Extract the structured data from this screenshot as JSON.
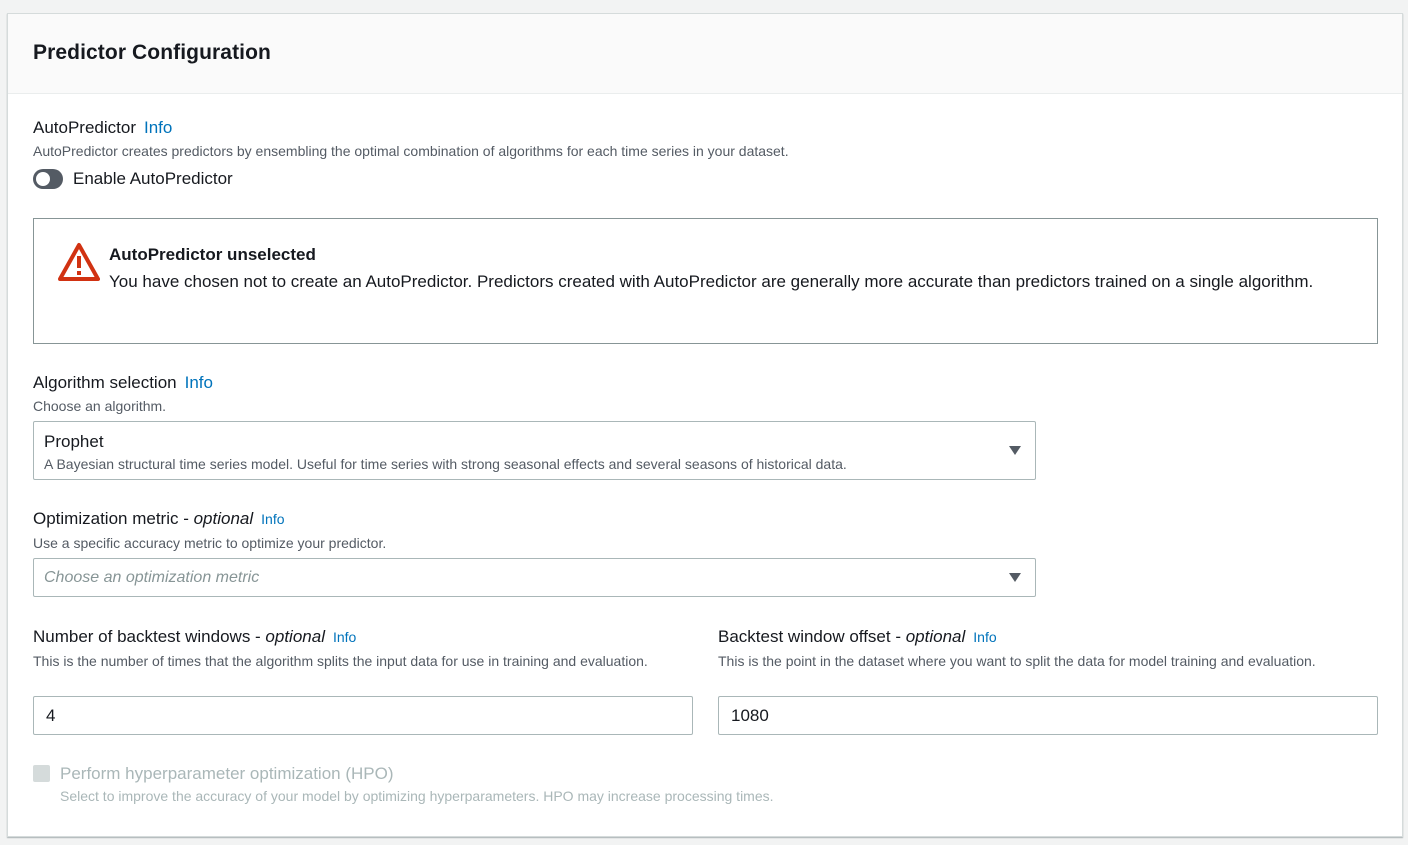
{
  "panel": {
    "title": "Predictor Configuration"
  },
  "autopredictor": {
    "label": "AutoPredictor",
    "info": "Info",
    "description": "AutoPredictor creates predictors by ensembling the optimal combination of algorithms for each time series in your dataset.",
    "toggle_label": "Enable AutoPredictor",
    "enabled": false
  },
  "alert": {
    "icon": "warning-triangle-icon",
    "title": "AutoPredictor unselected",
    "text": "You have chosen not to create an AutoPredictor. Predictors created with AutoPredictor are generally more accurate than predictors trained on a single algorithm."
  },
  "algorithm": {
    "label": "Algorithm selection",
    "info": "Info",
    "description": "Choose an algorithm.",
    "selected_value": "Prophet",
    "selected_description": "A Bayesian structural time series model. Useful for time series with strong seasonal effects and several seasons of historical data."
  },
  "optimization": {
    "label": "Optimization metric - ",
    "label_optional": "optional",
    "info": "Info",
    "description": "Use a specific accuracy metric to optimize your predictor.",
    "placeholder": "Choose an optimization metric"
  },
  "backtest_windows": {
    "label": "Number of backtest windows - ",
    "label_optional": "optional",
    "info": "Info",
    "description": "This is the number of times that the algorithm splits the input data for use in training and evaluation.",
    "value": "4"
  },
  "backtest_offset": {
    "label": "Backtest window offset - ",
    "label_optional": "optional",
    "info": "Info",
    "description": "This is the point in the dataset where you want to split the data for model training and evaluation.",
    "value": "1080"
  },
  "hpo": {
    "label": "Perform hyperparameter optimization (HPO)",
    "description": "Select to improve the accuracy of your model by optimizing hyperparameters. HPO may increase processing times.",
    "disabled": true
  },
  "colors": {
    "link": "#0073bb",
    "warning": "#d13212",
    "text": "#16191f",
    "secondary_text": "#545b64"
  }
}
